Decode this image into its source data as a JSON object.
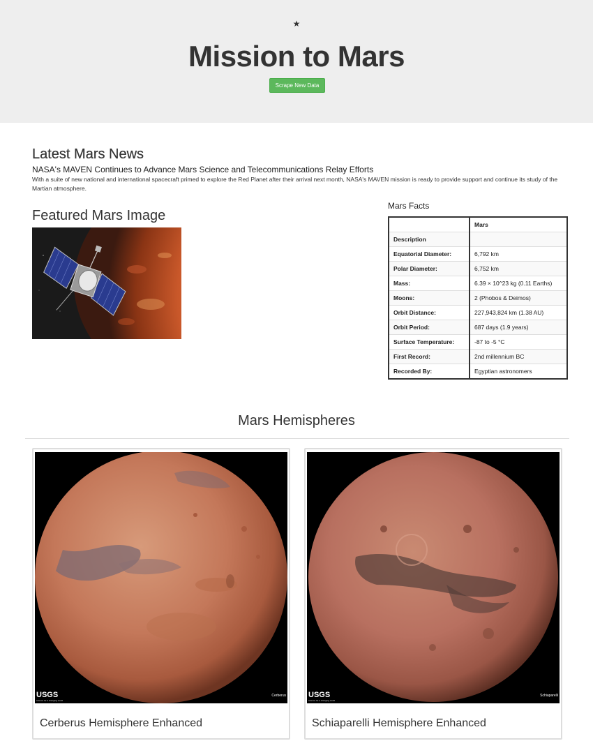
{
  "header": {
    "icon": "star-icon",
    "title": "Mission to Mars",
    "scrape_button": "Scrape New Data"
  },
  "news": {
    "heading": "Latest Mars News",
    "title": "NASA's MAVEN Continues to Advance Mars Science and Telecommunications Relay Efforts",
    "teaser": "With a suite of new national and international spacecraft primed to explore the Red Planet after their arrival next month, NASA's MAVEN mission is ready to provide support and continue its study of the Martian atmosphere."
  },
  "featured": {
    "heading": "Featured Mars Image"
  },
  "facts": {
    "heading": "Mars Facts",
    "column_header": "Mars",
    "index_label": "Description",
    "rows": [
      {
        "label": "Equatorial Diameter:",
        "value": "6,792 km"
      },
      {
        "label": "Polar Diameter:",
        "value": "6,752 km"
      },
      {
        "label": "Mass:",
        "value": "6.39 × 10^23 kg (0.11 Earths)"
      },
      {
        "label": "Moons:",
        "value": "2 (Phobos & Deimos)"
      },
      {
        "label": "Orbit Distance:",
        "value": "227,943,824 km (1.38 AU)"
      },
      {
        "label": "Orbit Period:",
        "value": "687 days (1.9 years)"
      },
      {
        "label": "Surface Temperature:",
        "value": "-87 to -5 °C"
      },
      {
        "label": "First Record:",
        "value": "2nd millennium BC"
      },
      {
        "label": "Recorded By:",
        "value": "Egyptian astronomers"
      }
    ]
  },
  "hemispheres": {
    "heading": "Mars Hemispheres",
    "items": [
      {
        "title": "Cerberus Hemisphere Enhanced",
        "image_label": "Cerberus",
        "logo": "USGS"
      },
      {
        "title": "Schiaparelli Hemisphere Enhanced",
        "image_label": "Schiaparelli",
        "logo": "USGS"
      }
    ]
  },
  "colors": {
    "header_bg": "#eeeeee",
    "button_bg": "#5cb85c",
    "text": "#333333",
    "mars_orange": "#c4674a"
  }
}
